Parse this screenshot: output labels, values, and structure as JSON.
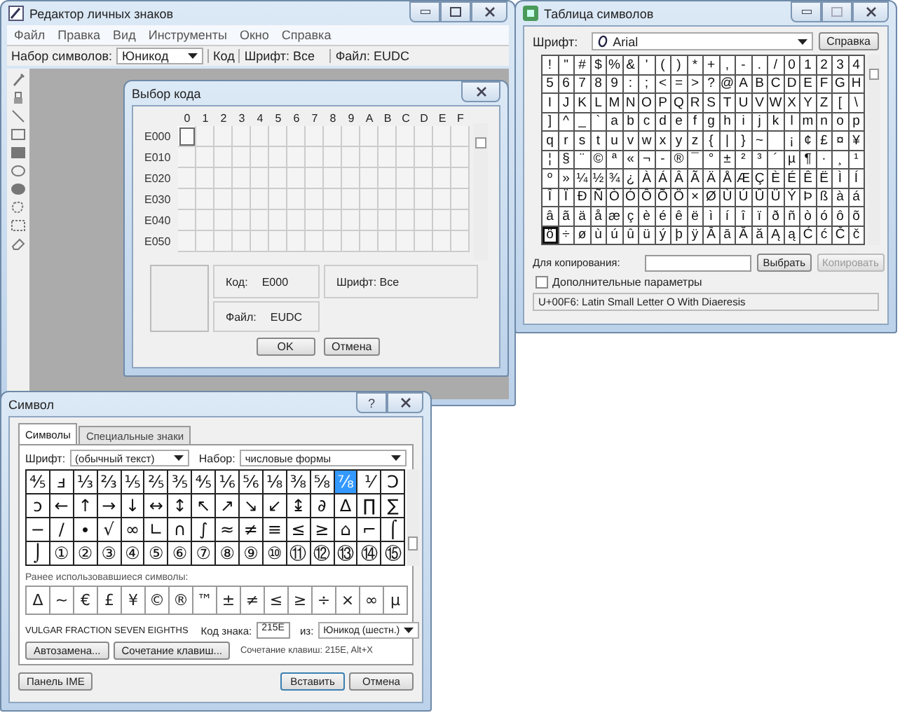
{
  "editor_window": {
    "title": "Редактор личных знаков",
    "menu": [
      "Файл",
      "Правка",
      "Вид",
      "Инструменты",
      "Окно",
      "Справка"
    ],
    "charset_label": "Набор символов:",
    "charset_value": "Юникод",
    "code_label": "Код",
    "font": "Шрифт: Все",
    "file": "Файл: EUDC"
  },
  "code_dialog": {
    "title": "Выбор кода",
    "columns": [
      "0",
      "1",
      "2",
      "3",
      "4",
      "5",
      "6",
      "7",
      "8",
      "9",
      "A",
      "B",
      "C",
      "D",
      "E",
      "F"
    ],
    "rows": [
      {
        "label": "E000",
        "cells": [
          {
            "selected": true
          },
          {
            "selected": false
          },
          {
            "selected": false
          },
          {
            "selected": false
          },
          {
            "selected": false
          },
          {
            "selected": false
          },
          {
            "selected": false
          },
          {
            "selected": false
          },
          {
            "selected": false
          },
          {
            "selected": false
          },
          {
            "selected": false
          },
          {
            "selected": false
          },
          {
            "selected": false
          },
          {
            "selected": false
          },
          {
            "selected": false
          },
          {
            "selected": false
          }
        ]
      },
      {
        "label": "E010",
        "cells": [
          {
            "selected": false
          },
          {
            "selected": false
          },
          {
            "selected": false
          },
          {
            "selected": false
          },
          {
            "selected": false
          },
          {
            "selected": false
          },
          {
            "selected": false
          },
          {
            "selected": false
          },
          {
            "selected": false
          },
          {
            "selected": false
          },
          {
            "selected": false
          },
          {
            "selected": false
          },
          {
            "selected": false
          },
          {
            "selected": false
          },
          {
            "selected": false
          },
          {
            "selected": false
          }
        ]
      },
      {
        "label": "E020",
        "cells": [
          {
            "selected": false
          },
          {
            "selected": false
          },
          {
            "selected": false
          },
          {
            "selected": false
          },
          {
            "selected": false
          },
          {
            "selected": false
          },
          {
            "selected": false
          },
          {
            "selected": false
          },
          {
            "selected": false
          },
          {
            "selected": false
          },
          {
            "selected": false
          },
          {
            "selected": false
          },
          {
            "selected": false
          },
          {
            "selected": false
          },
          {
            "selected": false
          },
          {
            "selected": false
          }
        ]
      },
      {
        "label": "E030",
        "cells": [
          {
            "selected": false
          },
          {
            "selected": false
          },
          {
            "selected": false
          },
          {
            "selected": false
          },
          {
            "selected": false
          },
          {
            "selected": false
          },
          {
            "selected": false
          },
          {
            "selected": false
          },
          {
            "selected": false
          },
          {
            "selected": false
          },
          {
            "selected": false
          },
          {
            "selected": false
          },
          {
            "selected": false
          },
          {
            "selected": false
          },
          {
            "selected": false
          },
          {
            "selected": false
          }
        ]
      },
      {
        "label": "E040",
        "cells": [
          {
            "selected": false
          },
          {
            "selected": false
          },
          {
            "selected": false
          },
          {
            "selected": false
          },
          {
            "selected": false
          },
          {
            "selected": false
          },
          {
            "selected": false
          },
          {
            "selected": false
          },
          {
            "selected": false
          },
          {
            "selected": false
          },
          {
            "selected": false
          },
          {
            "selected": false
          },
          {
            "selected": false
          },
          {
            "selected": false
          },
          {
            "selected": false
          },
          {
            "selected": false
          }
        ]
      },
      {
        "label": "E050",
        "cells": [
          {
            "selected": false
          },
          {
            "selected": false
          },
          {
            "selected": false
          },
          {
            "selected": false
          },
          {
            "selected": false
          },
          {
            "selected": false
          },
          {
            "selected": false
          },
          {
            "selected": false
          },
          {
            "selected": false
          },
          {
            "selected": false
          },
          {
            "selected": false
          },
          {
            "selected": false
          },
          {
            "selected": false
          },
          {
            "selected": false
          },
          {
            "selected": false
          },
          {
            "selected": false
          }
        ]
      }
    ],
    "code_label": "Код:",
    "code_value": "E000",
    "font": "Шрифт: Все",
    "file_label": "Файл:",
    "file_value": "EUDC",
    "buttons": [
      "OK",
      "Отмена"
    ]
  },
  "character_map": {
    "title": "Таблица символов",
    "font_label": "Шрифт:",
    "font_value": "Arial",
    "help_button": "Справка",
    "rows": [
      {
        "cells": [
          {
            "char": "!",
            "selected": false
          },
          {
            "char": "\"",
            "selected": false
          },
          {
            "char": "#",
            "selected": false
          },
          {
            "char": "$",
            "selected": false
          },
          {
            "char": "%",
            "selected": false
          },
          {
            "char": "&",
            "selected": false
          },
          {
            "char": "'",
            "selected": false
          },
          {
            "char": "(",
            "selected": false
          },
          {
            "char": ")",
            "selected": false
          },
          {
            "char": "*",
            "selected": false
          },
          {
            "char": "+",
            "selected": false
          },
          {
            "char": ",",
            "selected": false
          },
          {
            "char": "-",
            "selected": false
          },
          {
            "char": ".",
            "selected": false
          },
          {
            "char": "/",
            "selected": false
          },
          {
            "char": "0",
            "selected": false
          },
          {
            "char": "1",
            "selected": false
          },
          {
            "char": "2",
            "selected": false
          },
          {
            "char": "3",
            "selected": false
          },
          {
            "char": "4",
            "selected": false
          }
        ]
      },
      {
        "cells": [
          {
            "char": "5",
            "selected": false
          },
          {
            "char": "6",
            "selected": false
          },
          {
            "char": "7",
            "selected": false
          },
          {
            "char": "8",
            "selected": false
          },
          {
            "char": "9",
            "selected": false
          },
          {
            "char": ":",
            "selected": false
          },
          {
            "char": ";",
            "selected": false
          },
          {
            "char": "<",
            "selected": false
          },
          {
            "char": "=",
            "selected": false
          },
          {
            "char": ">",
            "selected": false
          },
          {
            "char": "?",
            "selected": false
          },
          {
            "char": "@",
            "selected": false
          },
          {
            "char": "A",
            "selected": false
          },
          {
            "char": "B",
            "selected": false
          },
          {
            "char": "C",
            "selected": false
          },
          {
            "char": "D",
            "selected": false
          },
          {
            "char": "E",
            "selected": false
          },
          {
            "char": "F",
            "selected": false
          },
          {
            "char": "G",
            "selected": false
          },
          {
            "char": "H",
            "selected": false
          }
        ]
      },
      {
        "cells": [
          {
            "char": "I",
            "selected": false
          },
          {
            "char": "J",
            "selected": false
          },
          {
            "char": "K",
            "selected": false
          },
          {
            "char": "L",
            "selected": false
          },
          {
            "char": "M",
            "selected": false
          },
          {
            "char": "N",
            "selected": false
          },
          {
            "char": "O",
            "selected": false
          },
          {
            "char": "P",
            "selected": false
          },
          {
            "char": "Q",
            "selected": false
          },
          {
            "char": "R",
            "selected": false
          },
          {
            "char": "S",
            "selected": false
          },
          {
            "char": "T",
            "selected": false
          },
          {
            "char": "U",
            "selected": false
          },
          {
            "char": "V",
            "selected": false
          },
          {
            "char": "W",
            "selected": false
          },
          {
            "char": "X",
            "selected": false
          },
          {
            "char": "Y",
            "selected": false
          },
          {
            "char": "Z",
            "selected": false
          },
          {
            "char": "[",
            "selected": false
          },
          {
            "char": "\\",
            "selected": false
          }
        ]
      },
      {
        "cells": [
          {
            "char": "]",
            "selected": false
          },
          {
            "char": "^",
            "selected": false
          },
          {
            "char": "_",
            "selected": false
          },
          {
            "char": "`",
            "selected": false
          },
          {
            "char": "a",
            "selected": false
          },
          {
            "char": "b",
            "selected": false
          },
          {
            "char": "c",
            "selected": false
          },
          {
            "char": "d",
            "selected": false
          },
          {
            "char": "e",
            "selected": false
          },
          {
            "char": "f",
            "selected": false
          },
          {
            "char": "g",
            "selected": false
          },
          {
            "char": "h",
            "selected": false
          },
          {
            "char": "i",
            "selected": false
          },
          {
            "char": "j",
            "selected": false
          },
          {
            "char": "k",
            "selected": false
          },
          {
            "char": "l",
            "selected": false
          },
          {
            "char": "m",
            "selected": false
          },
          {
            "char": "n",
            "selected": false
          },
          {
            "char": "o",
            "selected": false
          },
          {
            "char": "p",
            "selected": false
          }
        ]
      },
      {
        "cells": [
          {
            "char": "q",
            "selected": false
          },
          {
            "char": "r",
            "selected": false
          },
          {
            "char": "s",
            "selected": false
          },
          {
            "char": "t",
            "selected": false
          },
          {
            "char": "u",
            "selected": false
          },
          {
            "char": "v",
            "selected": false
          },
          {
            "char": "w",
            "selected": false
          },
          {
            "char": "x",
            "selected": false
          },
          {
            "char": "y",
            "selected": false
          },
          {
            "char": "z",
            "selected": false
          },
          {
            "char": "{",
            "selected": false
          },
          {
            "char": "|",
            "selected": false
          },
          {
            "char": "}",
            "selected": false
          },
          {
            "char": "~",
            "selected": false
          },
          {
            "selected": false
          },
          {
            "char": "¡",
            "selected": false
          },
          {
            "char": "¢",
            "selected": false
          },
          {
            "char": "£",
            "selected": false
          },
          {
            "char": "¤",
            "selected": false
          },
          {
            "char": "¥",
            "selected": false
          }
        ]
      },
      {
        "cells": [
          {
            "char": "¦",
            "selected": false
          },
          {
            "char": "§",
            "selected": false
          },
          {
            "char": "¨",
            "selected": false
          },
          {
            "char": "©",
            "selected": false
          },
          {
            "char": "ª",
            "selected": false
          },
          {
            "char": "«",
            "selected": false
          },
          {
            "char": "¬",
            "selected": false
          },
          {
            "char": "-",
            "selected": false
          },
          {
            "char": "®",
            "selected": false
          },
          {
            "char": "¯",
            "selected": false
          },
          {
            "char": "°",
            "selected": false
          },
          {
            "char": "±",
            "selected": false
          },
          {
            "char": "²",
            "selected": false
          },
          {
            "char": "³",
            "selected": false
          },
          {
            "char": "´",
            "selected": false
          },
          {
            "char": "µ",
            "selected": false
          },
          {
            "char": "¶",
            "selected": false
          },
          {
            "char": "·",
            "selected": false
          },
          {
            "char": "¸",
            "selected": false
          },
          {
            "char": "¹",
            "selected": false
          }
        ]
      },
      {
        "cells": [
          {
            "char": "º",
            "selected": false
          },
          {
            "char": "»",
            "selected": false
          },
          {
            "char": "¼",
            "selected": false
          },
          {
            "char": "½",
            "selected": false
          },
          {
            "char": "¾",
            "selected": false
          },
          {
            "char": "¿",
            "selected": false
          },
          {
            "char": "À",
            "selected": false
          },
          {
            "char": "Á",
            "selected": false
          },
          {
            "char": "Â",
            "selected": false
          },
          {
            "char": "Ã",
            "selected": false
          },
          {
            "char": "Ä",
            "selected": false
          },
          {
            "char": "Å",
            "selected": false
          },
          {
            "char": "Æ",
            "selected": false
          },
          {
            "char": "Ç",
            "selected": false
          },
          {
            "char": "È",
            "selected": false
          },
          {
            "char": "É",
            "selected": false
          },
          {
            "char": "Ê",
            "selected": false
          },
          {
            "char": "Ë",
            "selected": false
          },
          {
            "char": "Ì",
            "selected": false
          },
          {
            "char": "Í",
            "selected": false
          }
        ]
      },
      {
        "cells": [
          {
            "char": "Î",
            "selected": false
          },
          {
            "char": "Ï",
            "selected": false
          },
          {
            "char": "Ð",
            "selected": false
          },
          {
            "char": "Ñ",
            "selected": false
          },
          {
            "char": "Ò",
            "selected": false
          },
          {
            "char": "Ó",
            "selected": false
          },
          {
            "char": "Ô",
            "selected": false
          },
          {
            "char": "Õ",
            "selected": false
          },
          {
            "char": "Ö",
            "selected": false
          },
          {
            "char": "×",
            "selected": false
          },
          {
            "char": "Ø",
            "selected": false
          },
          {
            "char": "Ù",
            "selected": false
          },
          {
            "char": "Ú",
            "selected": false
          },
          {
            "char": "Û",
            "selected": false
          },
          {
            "char": "Ü",
            "selected": false
          },
          {
            "char": "Ý",
            "selected": false
          },
          {
            "char": "Þ",
            "selected": false
          },
          {
            "char": "ß",
            "selected": false
          },
          {
            "char": "à",
            "selected": false
          },
          {
            "char": "á",
            "selected": false
          }
        ]
      },
      {
        "cells": [
          {
            "char": "â",
            "selected": false
          },
          {
            "char": "ã",
            "selected": false
          },
          {
            "char": "ä",
            "selected": false
          },
          {
            "char": "å",
            "selected": false
          },
          {
            "char": "æ",
            "selected": false
          },
          {
            "char": "ç",
            "selected": false
          },
          {
            "char": "è",
            "selected": false
          },
          {
            "char": "é",
            "selected": false
          },
          {
            "char": "ê",
            "selected": false
          },
          {
            "char": "ë",
            "selected": false
          },
          {
            "char": "ì",
            "selected": false
          },
          {
            "char": "í",
            "selected": false
          },
          {
            "char": "î",
            "selected": false
          },
          {
            "char": "ï",
            "selected": false
          },
          {
            "char": "ð",
            "selected": false
          },
          {
            "char": "ñ",
            "selected": false
          },
          {
            "char": "ò",
            "selected": false
          },
          {
            "char": "ó",
            "selected": false
          },
          {
            "char": "ô",
            "selected": false
          },
          {
            "char": "õ",
            "selected": false
          }
        ]
      },
      {
        "cells": [
          {
            "char": "ö",
            "selected": true
          },
          {
            "char": "÷",
            "selected": false
          },
          {
            "char": "ø",
            "selected": false
          },
          {
            "char": "ù",
            "selected": false
          },
          {
            "char": "ú",
            "selected": false
          },
          {
            "char": "û",
            "selected": false
          },
          {
            "char": "ü",
            "selected": false
          },
          {
            "char": "ý",
            "selected": false
          },
          {
            "char": "þ",
            "selected": false
          },
          {
            "char": "ÿ",
            "selected": false
          },
          {
            "char": "Ā",
            "selected": false
          },
          {
            "char": "ā",
            "selected": false
          },
          {
            "char": "Ă",
            "selected": false
          },
          {
            "char": "ă",
            "selected": false
          },
          {
            "char": "Ą",
            "selected": false
          },
          {
            "char": "ą",
            "selected": false
          },
          {
            "char": "Ć",
            "selected": false
          },
          {
            "char": "ć",
            "selected": false
          },
          {
            "char": "Č",
            "selected": false
          },
          {
            "char": "č",
            "selected": false
          }
        ]
      }
    ],
    "copy_label": "Для копирования:",
    "select_button": "Выбрать",
    "copy_button": {
      "label": "Копировать",
      "disabled": true
    },
    "advanced": {
      "label": "Дополнительные параметры",
      "checked": false
    },
    "status": "U+00F6: Latin Small Letter O With Diaeresis"
  },
  "symbol_dialog": {
    "title": "Символ",
    "help_glyph": "?",
    "tabs": [
      {
        "label": "Символы",
        "selected": true
      },
      {
        "label": "Специальные знаки",
        "selected": false
      }
    ],
    "font_label": "Шрифт:",
    "font_value": "(обычный текст)",
    "subset_label": "Набор:",
    "subset_value": "числовые формы",
    "rows": [
      {
        "cells": [
          {
            "char": "⅘",
            "selected": false
          },
          {
            "char": "ⅎ",
            "selected": false
          },
          {
            "char": "⅓",
            "selected": false
          },
          {
            "char": "⅔",
            "selected": false
          },
          {
            "char": "⅕",
            "selected": false
          },
          {
            "char": "⅖",
            "selected": false
          },
          {
            "char": "⅗",
            "selected": false
          },
          {
            "char": "⅘",
            "selected": false
          },
          {
            "char": "⅙",
            "selected": false
          },
          {
            "char": "⅚",
            "selected": false
          },
          {
            "char": "⅛",
            "selected": false
          },
          {
            "char": "⅜",
            "selected": false
          },
          {
            "char": "⅝",
            "selected": false
          },
          {
            "char": "⅞",
            "selected": true
          },
          {
            "char": "⅟",
            "selected": false
          },
          {
            "char": "Ↄ",
            "selected": false
          }
        ]
      },
      {
        "cells": [
          {
            "char": "ↄ",
            "selected": false
          },
          {
            "char": "←",
            "selected": false
          },
          {
            "char": "↑",
            "selected": false
          },
          {
            "char": "→",
            "selected": false
          },
          {
            "char": "↓",
            "selected": false
          },
          {
            "char": "↔",
            "selected": false
          },
          {
            "char": "↕",
            "selected": false
          },
          {
            "char": "↖",
            "selected": false
          },
          {
            "char": "↗",
            "selected": false
          },
          {
            "char": "↘",
            "selected": false
          },
          {
            "char": "↙",
            "selected": false
          },
          {
            "char": "↨",
            "selected": false
          },
          {
            "char": "∂",
            "selected": false
          },
          {
            "char": "∆",
            "selected": false
          },
          {
            "char": "∏",
            "selected": false
          },
          {
            "char": "∑",
            "selected": false
          }
        ]
      },
      {
        "cells": [
          {
            "char": "−",
            "selected": false
          },
          {
            "char": "∕",
            "selected": false
          },
          {
            "char": "∙",
            "selected": false
          },
          {
            "char": "√",
            "selected": false
          },
          {
            "char": "∞",
            "selected": false
          },
          {
            "char": "∟",
            "selected": false
          },
          {
            "char": "∩",
            "selected": false
          },
          {
            "char": "∫",
            "selected": false
          },
          {
            "char": "≈",
            "selected": false
          },
          {
            "char": "≠",
            "selected": false
          },
          {
            "char": "≡",
            "selected": false
          },
          {
            "char": "≤",
            "selected": false
          },
          {
            "char": "≥",
            "selected": false
          },
          {
            "char": "⌂",
            "selected": false
          },
          {
            "char": "⌐",
            "selected": false
          },
          {
            "char": "⌠",
            "selected": false
          }
        ]
      },
      {
        "cells": [
          {
            "char": "⌡",
            "selected": false
          },
          {
            "char": "①",
            "selected": false
          },
          {
            "char": "②",
            "selected": false
          },
          {
            "char": "③",
            "selected": false
          },
          {
            "char": "④",
            "selected": false
          },
          {
            "char": "⑤",
            "selected": false
          },
          {
            "char": "⑥",
            "selected": false
          },
          {
            "char": "⑦",
            "selected": false
          },
          {
            "char": "⑧",
            "selected": false
          },
          {
            "char": "⑨",
            "selected": false
          },
          {
            "char": "⑩",
            "selected": false
          },
          {
            "char": "⑪",
            "selected": false
          },
          {
            "char": "⑫",
            "selected": false
          },
          {
            "char": "⑬",
            "selected": false
          },
          {
            "char": "⑭",
            "selected": false
          },
          {
            "char": "⑮",
            "selected": false
          }
        ]
      }
    ],
    "recent_label": "Ранее использовавшиеся символы:",
    "recent": [
      "Δ",
      "~",
      "€",
      "£",
      "¥",
      "©",
      "®",
      "™",
      "±",
      "≠",
      "≤",
      "≥",
      "÷",
      "×",
      "∞",
      "µ"
    ],
    "char_name": "VULGAR FRACTION SEVEN EIGHTHS",
    "code_label": "Код знака:",
    "code_value": "215E",
    "from_label": "из:",
    "from_value": "Юникод (шестн.)",
    "autocorrect_button": "Автозамена...",
    "shortcut_button": "Сочетание клавиш...",
    "shortcut_text": "Сочетание клавиш: 215E, Alt+X",
    "ime_button": "Панель IME",
    "insert_button": "Вставить",
    "cancel_button": "Отмена"
  }
}
